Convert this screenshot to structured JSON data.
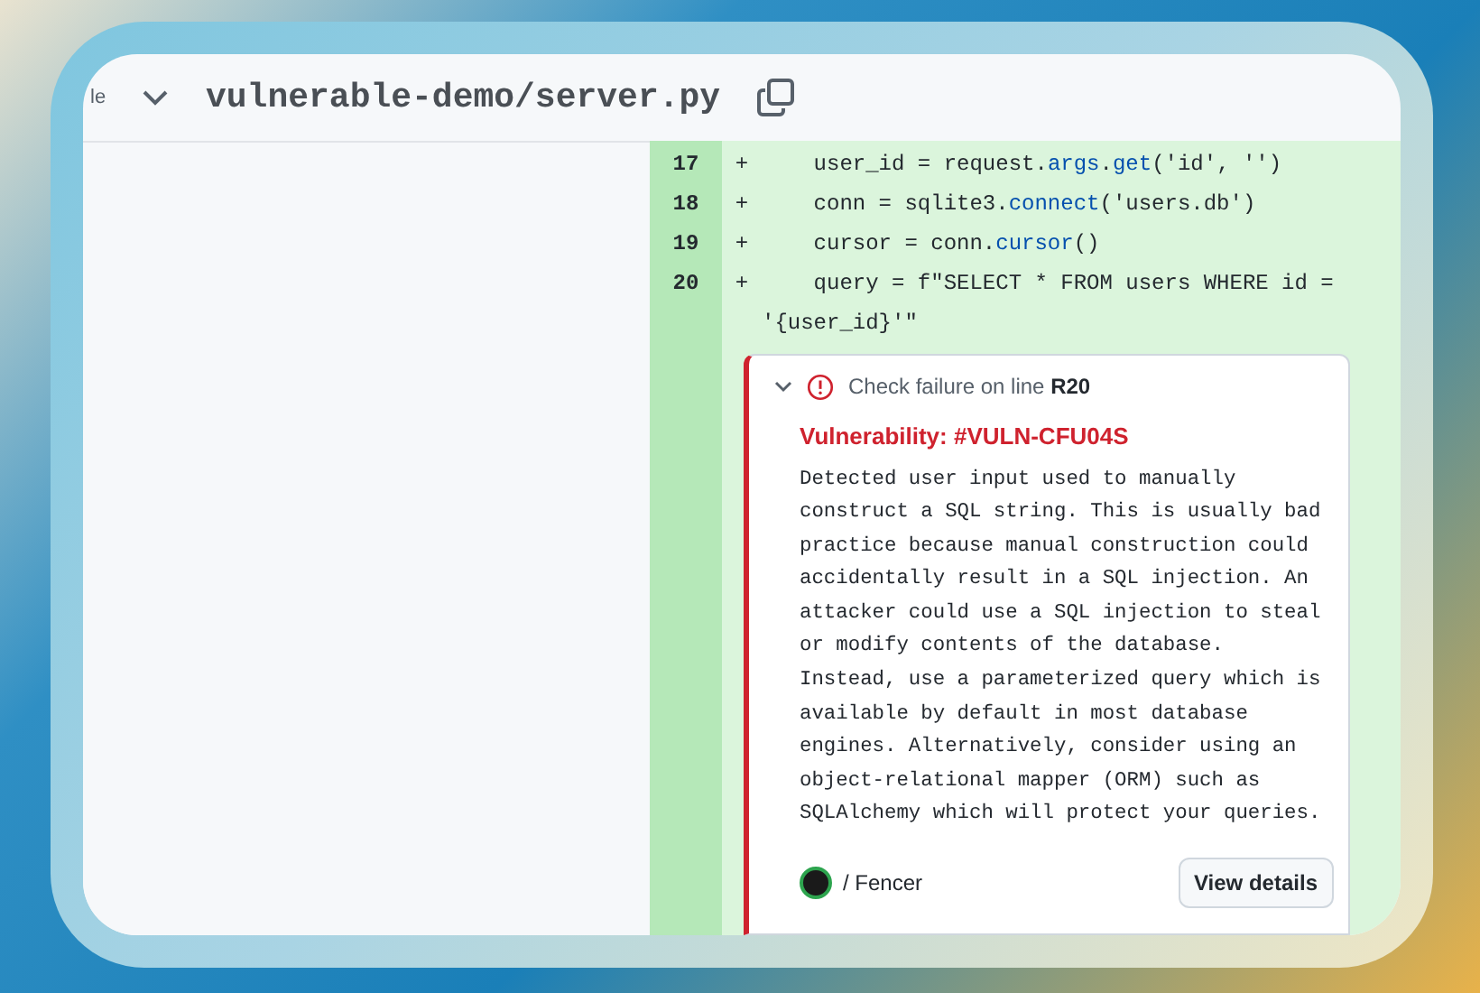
{
  "header": {
    "cut_label": "le",
    "file_path": "vulnerable-demo/server.py"
  },
  "diff_lines": [
    {
      "number": "17",
      "marker": "+",
      "segments": [
        {
          "text": "    user_id = request.",
          "kind": "plain"
        },
        {
          "text": "args",
          "kind": "call"
        },
        {
          "text": ".",
          "kind": "plain"
        },
        {
          "text": "get",
          "kind": "call"
        },
        {
          "text": "('id', '')",
          "kind": "plain"
        }
      ]
    },
    {
      "number": "18",
      "marker": "+",
      "segments": [
        {
          "text": "    conn = sqlite3.",
          "kind": "plain"
        },
        {
          "text": "connect",
          "kind": "call"
        },
        {
          "text": "('users.db')",
          "kind": "plain"
        }
      ]
    },
    {
      "number": "19",
      "marker": "+",
      "segments": [
        {
          "text": "    cursor = conn.",
          "kind": "plain"
        },
        {
          "text": "cursor",
          "kind": "call"
        },
        {
          "text": "()",
          "kind": "plain"
        }
      ]
    },
    {
      "number": "20",
      "marker": "+",
      "segments": [
        {
          "text": "    query = f\"SELECT * FROM users WHERE id =",
          "kind": "plain"
        }
      ],
      "continuation": "'{user_id}'\""
    }
  ],
  "annotation": {
    "expanded": true,
    "title_prefix": "Check failure on line",
    "line_ref": "R20",
    "heading": "Vulnerability: #VULN-CFU04S",
    "body": "Detected user input used to manually construct a SQL string. This is usually bad practice because manual construction could accidentally result in a SQL injection. An attacker could use a SQL injection to steal or modify contents of the database. Instead, use a parameterized query which is available by default in most database engines. Alternatively, consider using an object-relational mapper (ORM) such as SQLAlchemy which will protect your queries.",
    "app_name": "/ Fencer",
    "button": "View details"
  }
}
